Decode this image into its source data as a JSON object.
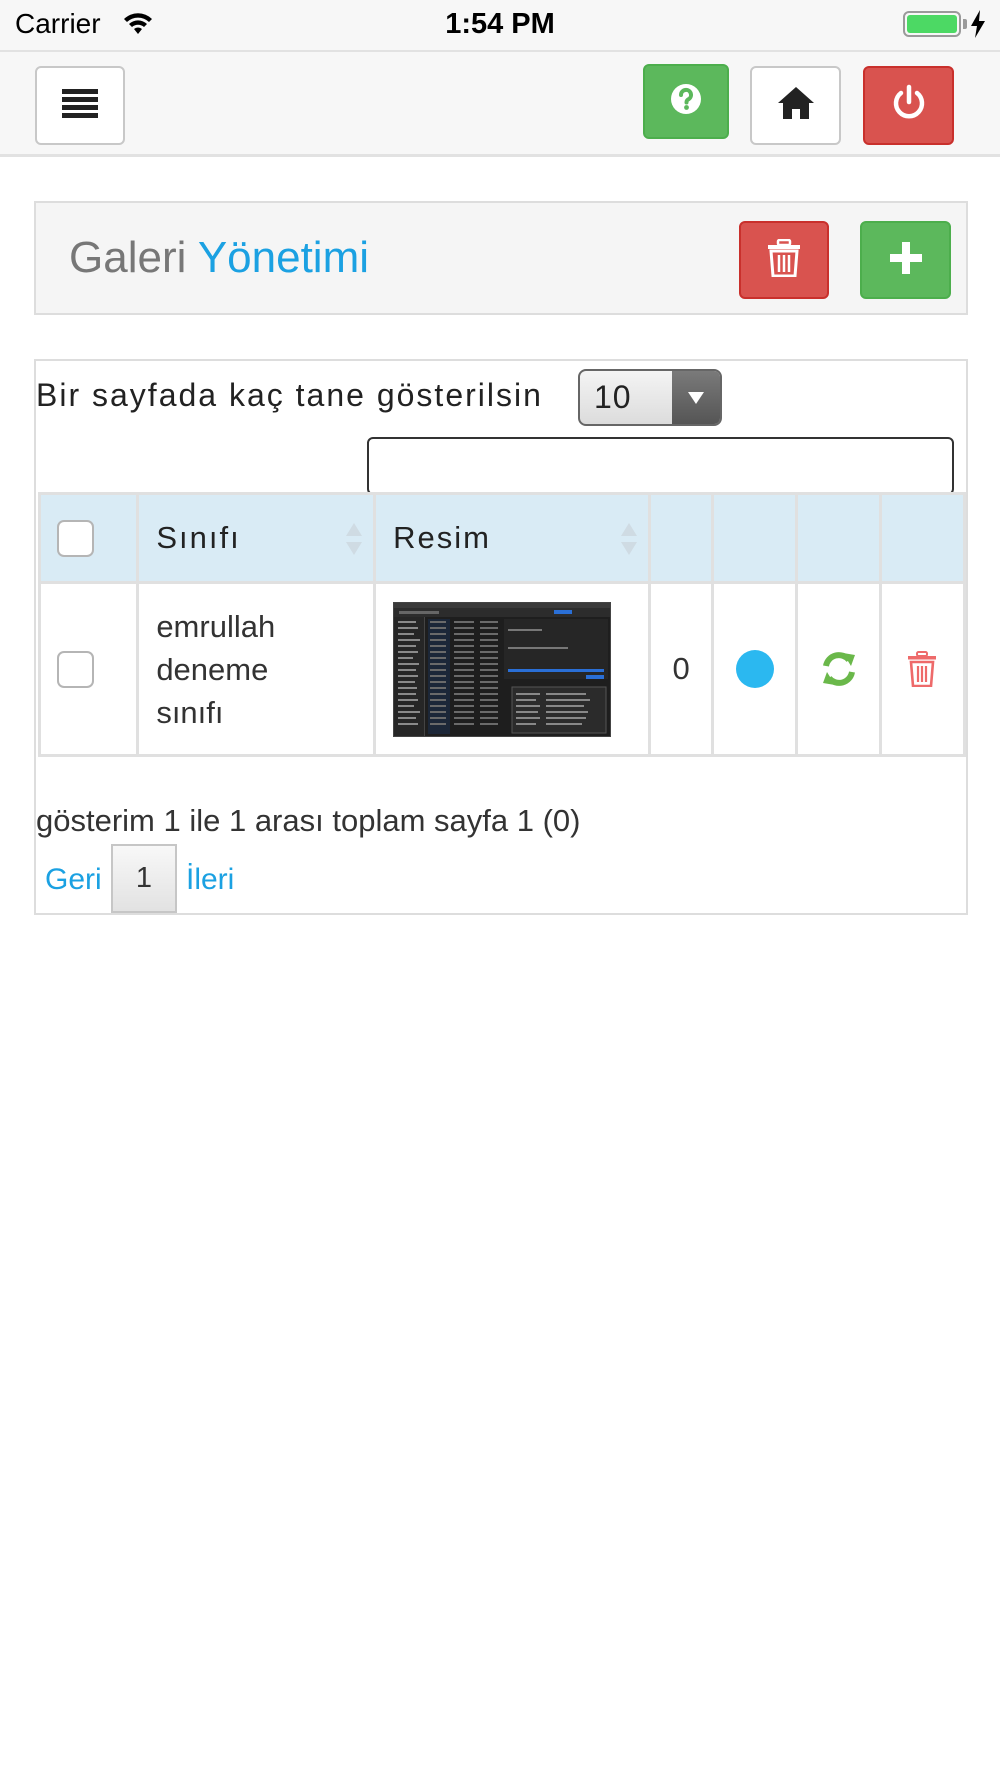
{
  "status_bar": {
    "carrier": "Carrier",
    "time": "1:54 PM",
    "battery_color": "#4cd964"
  },
  "navbar": {
    "menu_icon": "hamburger-icon",
    "help_icon": "question-circle-icon",
    "home_icon": "home-icon",
    "power_icon": "power-icon"
  },
  "panel": {
    "title_prefix": "Galeri",
    "title_accent": "Yönetimi",
    "accent_color": "#1ba1e2",
    "delete_all_icon": "trash-icon",
    "add_icon": "plus-icon"
  },
  "table_controls": {
    "length_label": "Bir sayfada kaç tane gösterilsin",
    "length_value": "10",
    "search_value": ""
  },
  "table": {
    "columns": [
      "",
      "Sınıfı",
      "Resim",
      "",
      "",
      "",
      ""
    ],
    "rows": [
      {
        "checked": false,
        "sinifi": "emrullah deneme sınıfı",
        "resim": "screenshot-thumbnail",
        "count": "0",
        "status_color": "#2bb8f0",
        "refresh_icon": "refresh-icon",
        "delete_icon": "trash-icon"
      }
    ]
  },
  "footer": {
    "info": "gösterim 1 ile 1 arası toplam sayfa 1 (0)",
    "prev": "Geri",
    "current_page": "1",
    "next": "İleri"
  }
}
